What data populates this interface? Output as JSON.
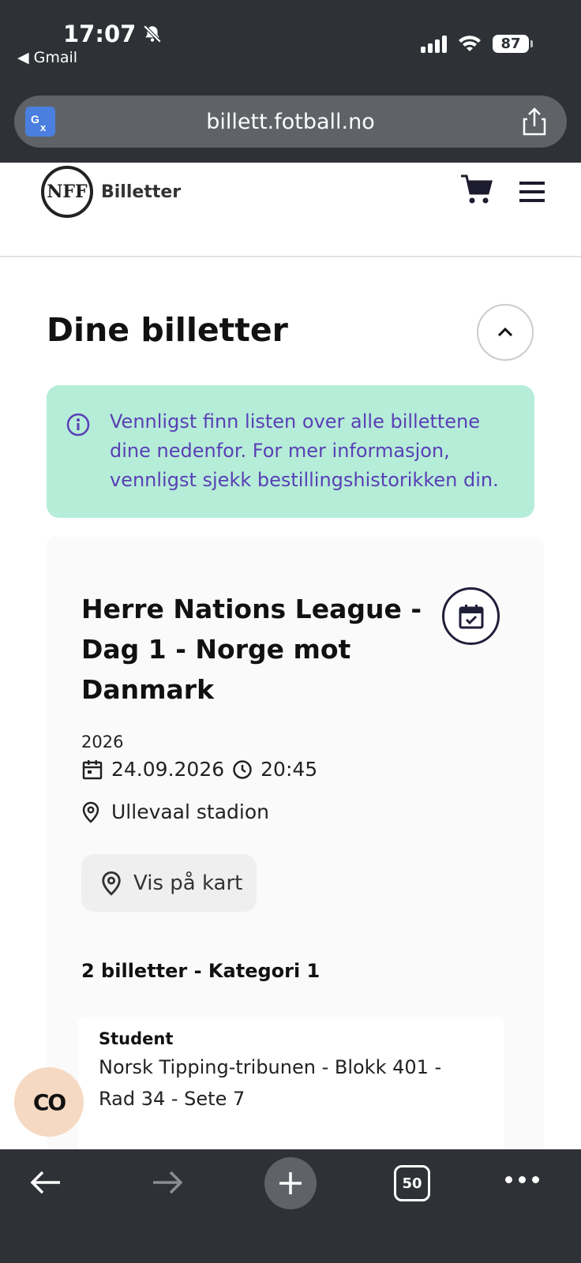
{
  "status_bar": {
    "time": "17:07",
    "back_app": "Gmail",
    "battery": "87"
  },
  "browser": {
    "url": "billett.fotball.no",
    "tab_count": "50"
  },
  "site": {
    "logo_mark": "NFF",
    "logo_text": "Billetter"
  },
  "page": {
    "title": "Dine billetter",
    "info_text": "Vennligst finn listen over alle billettene dine nedenfor. For mer informasjon, vennligst sjekk bestillingshistorikken din."
  },
  "event": {
    "title": "Herre Nations League - Dag 1 - Norge mot Danmark",
    "year": "2026",
    "date": "24.09.2026",
    "time": "20:45",
    "location": "Ullevaal stadion",
    "map_button": "Vis på kart",
    "ticket_summary": "2 billetter - Kategori 1"
  },
  "ticket": {
    "type": "Student",
    "seat": "Norsk Tipping-tribunen - Blokk 401 - Rad 34 - Sete 7"
  },
  "floating_button": {
    "label": "CO"
  },
  "colors": {
    "chrome_bg": "#2e3135",
    "info_bg": "#b5edd8",
    "info_text": "#5a3fb5",
    "co_button_bg": "#f6d9c2"
  }
}
